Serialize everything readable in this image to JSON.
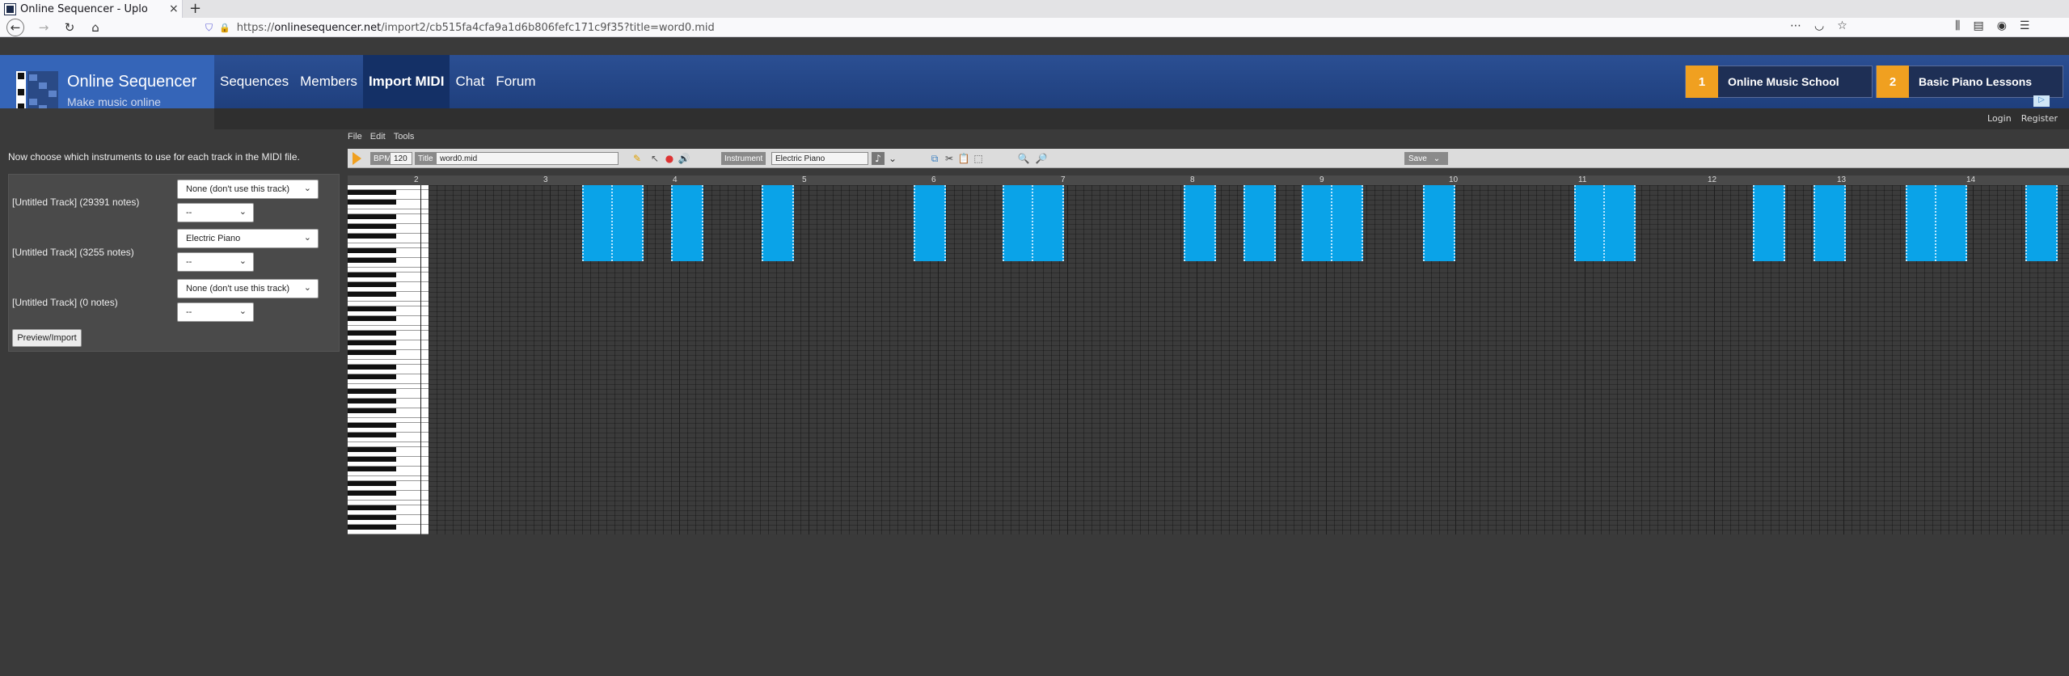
{
  "browser": {
    "tab_title": "Online Sequencer - Uplo",
    "url_prefix": "https://",
    "url_host": "onlinesequencer.net",
    "url_path": "/import2/cb515fa4cfa9a1d6b806fefc171c9f35?title=word0.mid",
    "new_tab": "+",
    "close_tab": "×"
  },
  "site": {
    "name": "Online Sequencer",
    "tagline": "Make music online",
    "nav": [
      "Sequences",
      "Members",
      "Import MIDI",
      "Chat",
      "Forum"
    ],
    "active_nav": "Import MIDI",
    "ads": [
      {
        "num": "1",
        "label": "Online Music School"
      },
      {
        "num": "2",
        "label": "Basic Piano Lessons"
      }
    ],
    "login": "Login",
    "register": "Register"
  },
  "import": {
    "instruction": "Now choose which instruments to use for each track in the MIDI file.",
    "tracks": [
      {
        "label": "[Untitled Track] (29391 notes)",
        "instrument": "None (don't use this track)",
        "option": "--"
      },
      {
        "label": "[Untitled Track] (3255 notes)",
        "instrument": "Electric Piano",
        "option": "--"
      },
      {
        "label": "[Untitled Track] (0 notes)",
        "instrument": "None (don't use this track)",
        "option": "--"
      }
    ],
    "preview_button": "Preview/Import"
  },
  "sequencer": {
    "menu": [
      "File",
      "Edit",
      "Tools"
    ],
    "bpm_label": "BPM",
    "bpm": "120",
    "title_label": "Title",
    "title": "word0.mid",
    "instrument_label": "Instrument",
    "instrument": "Electric Piano",
    "save_label": "Save",
    "ruler": [
      "2",
      "3",
      "4",
      "5",
      "6",
      "7",
      "8",
      "9",
      "10",
      "11",
      "12",
      "13",
      "14"
    ],
    "note_color": "#0aa3e8"
  }
}
